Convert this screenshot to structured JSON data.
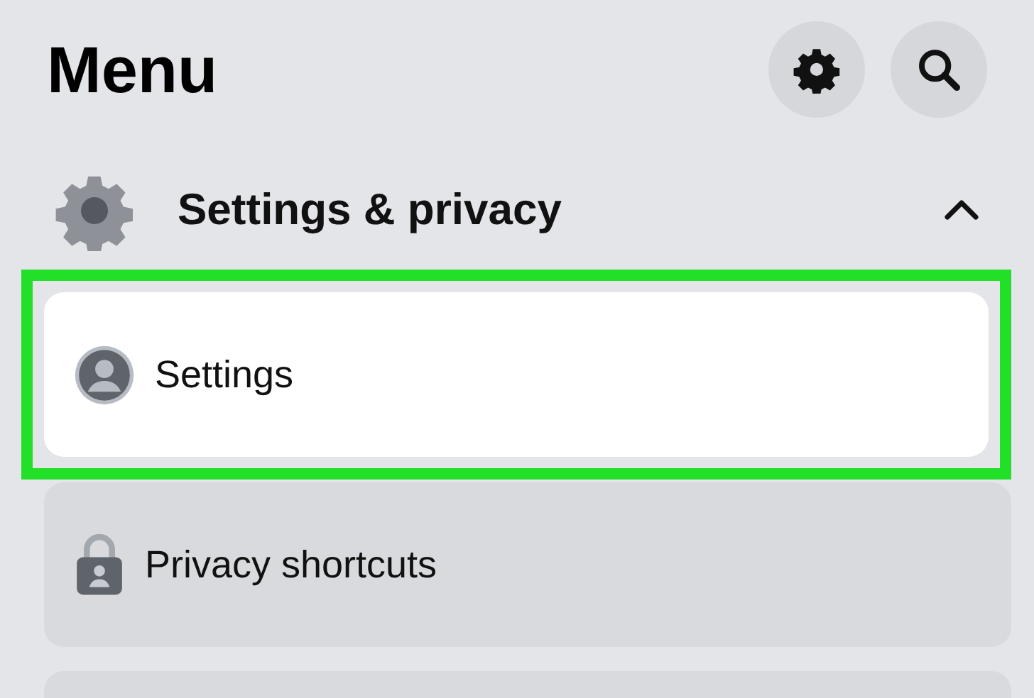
{
  "header": {
    "title": "Menu"
  },
  "section": {
    "label": "Settings & privacy",
    "expanded": true
  },
  "items": [
    {
      "label": "Settings",
      "kind": "account",
      "selected": true,
      "highlighted": true
    },
    {
      "label": "Privacy shortcuts",
      "kind": "lock",
      "selected": false,
      "highlighted": false
    }
  ]
}
